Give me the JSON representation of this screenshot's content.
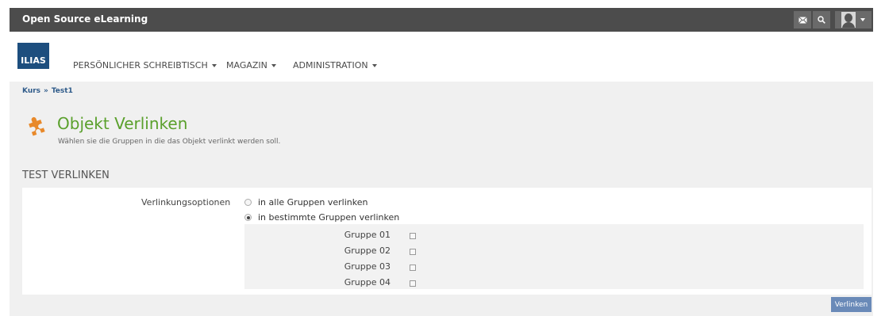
{
  "topbar": {
    "brand": "Open Source eLearning"
  },
  "logo": {
    "text": "ILIAS"
  },
  "nav": {
    "items": [
      {
        "label": "PERSÖNLICHER SCHREIBTISCH"
      },
      {
        "label": "MAGAZIN"
      },
      {
        "label": "ADMINISTRATION"
      }
    ]
  },
  "breadcrumb": {
    "items": [
      "Kurs",
      "Test1"
    ],
    "separator": "»"
  },
  "header": {
    "title": "Objekt Verlinken",
    "description": "Wählen sie die Gruppen in die das Objekt verlinkt werden soll."
  },
  "section": {
    "title": "TEST VERLINKEN"
  },
  "form": {
    "option_label": "Verlinkungsoptionen",
    "radios": [
      {
        "label": "in alle Gruppen verlinken",
        "checked": false
      },
      {
        "label": "in bestimmte Gruppen verlinken",
        "checked": true
      }
    ],
    "groups": [
      {
        "label": "Gruppe 01",
        "checked": false
      },
      {
        "label": "Gruppe 02",
        "checked": false
      },
      {
        "label": "Gruppe 03",
        "checked": false
      },
      {
        "label": "Gruppe 04",
        "checked": false
      }
    ],
    "submit_label": "Verlinken"
  },
  "colors": {
    "title_green": "#5aa02c",
    "topbar": "#4c4c4c",
    "logo_blue": "#1d4e7e",
    "button_blue": "#6a8ab8",
    "icon_orange": "#e8892a"
  }
}
